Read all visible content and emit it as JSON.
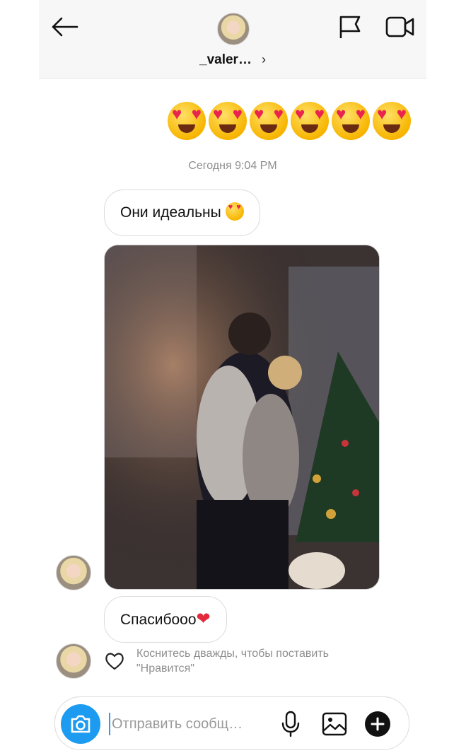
{
  "header": {
    "username": "_valer…",
    "chevron": "›"
  },
  "messages": {
    "sent_emojis": [
      "heart-eyes-emoji",
      "heart-eyes-emoji",
      "heart-eyes-emoji",
      "heart-eyes-emoji",
      "heart-eyes-emoji",
      "heart-eyes-emoji"
    ],
    "timestamp": "Сегодня 9:04 PM",
    "received_1_text": "Они идеальны",
    "received_2_text": "Спасибооо",
    "received_2_emoji": "❤"
  },
  "like_hint": "Коснитесь дважды, чтобы поставить \"Нравится\"",
  "composer": {
    "placeholder": "Отправить сообщ…"
  },
  "colors": {
    "camera_button": "#1d9bf0",
    "heart_red": "#e32a3d"
  }
}
